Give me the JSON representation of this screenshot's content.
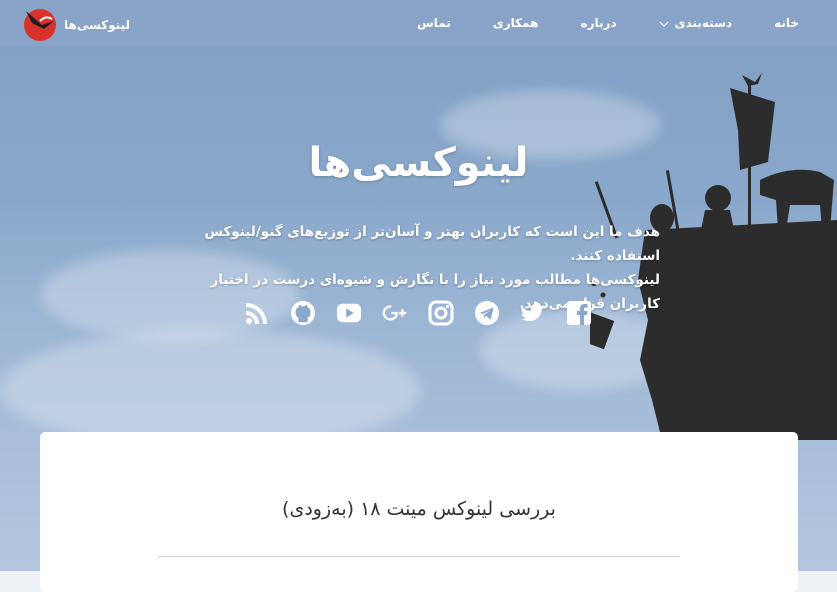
{
  "nav": {
    "brand": "لینوکسی‌ها",
    "items": [
      {
        "label": "خانه"
      },
      {
        "label": "دسته‌بندی"
      },
      {
        "label": "درباره"
      },
      {
        "label": "همکاری"
      },
      {
        "label": "تماس"
      }
    ]
  },
  "hero": {
    "title": "لینوکسی‌ها",
    "tagline_line1": "هدف ما این است که کاربران بهتر و آسان‌تر از توزیع‌های گنو/لینوکس استفاده کنند.",
    "tagline_line2": "لینوکسی‌ها مطالب مورد نیاز را با نگارش و شیوه‌ای درست در اختیار کاربران قرار می‌دهد."
  },
  "social": [
    "facebook-icon",
    "twitter-icon",
    "telegram-icon",
    "instagram-icon",
    "google-plus-icon",
    "youtube-icon",
    "github-icon",
    "rss-icon"
  ],
  "post": {
    "title": "بررسی لینوکس مینت ۱۸ (به‌زودی)"
  },
  "colors": {
    "sky": "#8aa8cb",
    "silhouette": "#2c2c2c",
    "logo_red": "#d8322b"
  }
}
